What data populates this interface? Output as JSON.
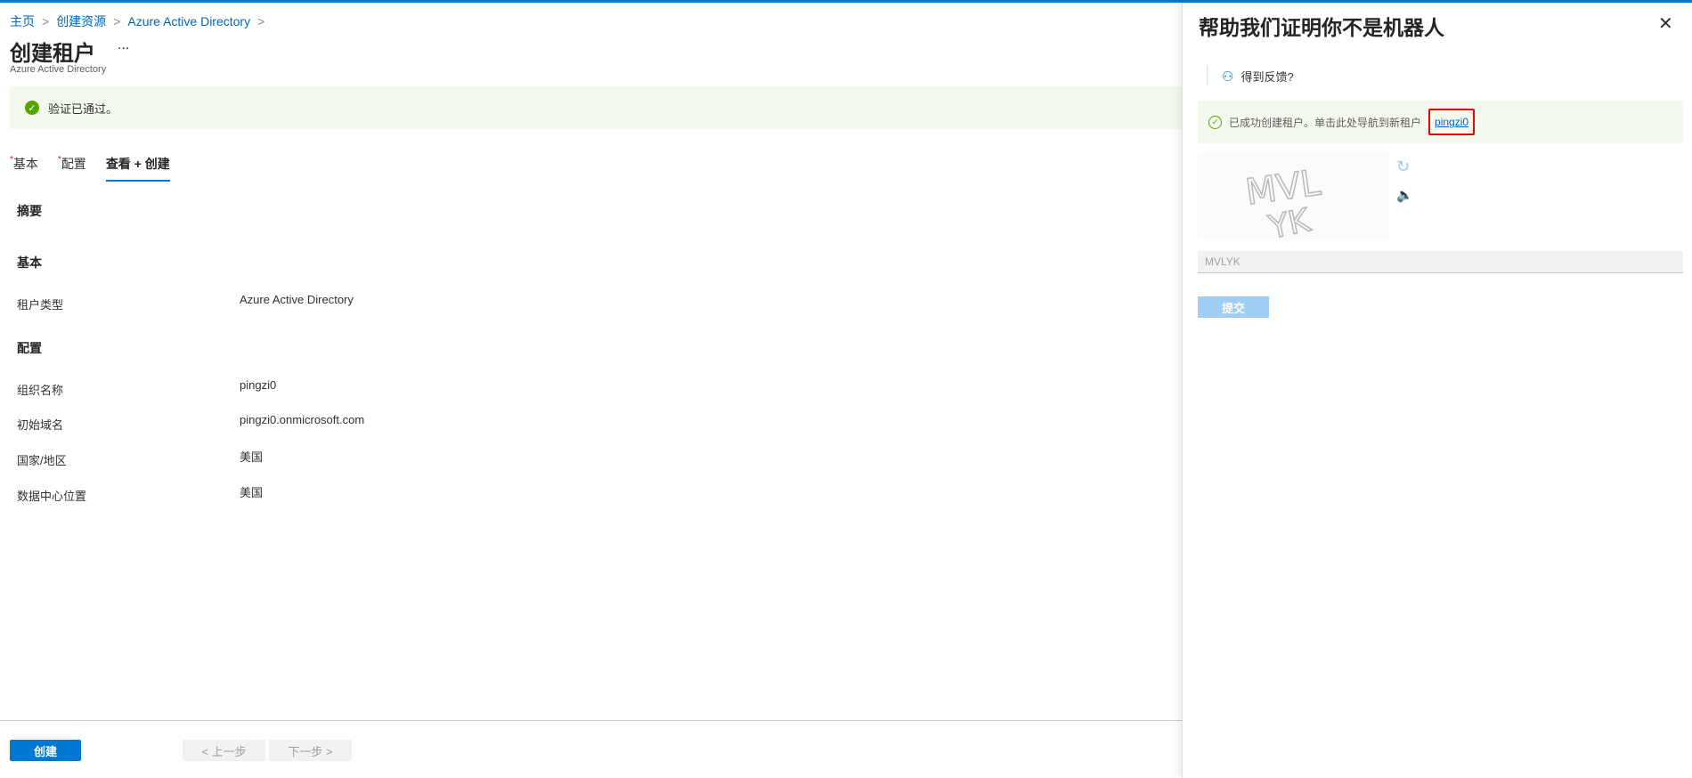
{
  "breadcrumb": [
    "主页",
    "创建资源",
    "Azure Active Directory"
  ],
  "header": {
    "title": "创建租户",
    "more": "...",
    "subtitle": "Azure Active Directory"
  },
  "banner": {
    "text": "验证已通过。"
  },
  "tabs": [
    {
      "label": "基本",
      "required": true
    },
    {
      "label": "配置",
      "required": true
    },
    {
      "label": "查看 + 创建",
      "required": false
    }
  ],
  "summary": {
    "heading": "摘要",
    "basic_heading": "基本",
    "basic": [
      {
        "label": "租户类型",
        "value": "Azure Active Directory"
      }
    ],
    "config_heading": "配置",
    "config": [
      {
        "label": "组织名称",
        "value": "pingzi0"
      },
      {
        "label": "初始域名",
        "value": "pingzi0.onmicrosoft.com"
      },
      {
        "label": "国家/地区",
        "value": "美国"
      },
      {
        "label": "数据中心位置",
        "value": "美国"
      }
    ]
  },
  "footer": {
    "create": "创建",
    "prev": "< 上一步",
    "next": "下一步 >"
  },
  "panel": {
    "title": "帮助我们证明你不是机器人",
    "feedback": "得到反馈?",
    "success_text": "已成功创建租户。单击此处导航到新租户",
    "tenant_link": "pingzi0",
    "captcha_text": "MVLYK",
    "input_value": "MVLYK",
    "submit": "提交"
  },
  "required_marker": "*"
}
